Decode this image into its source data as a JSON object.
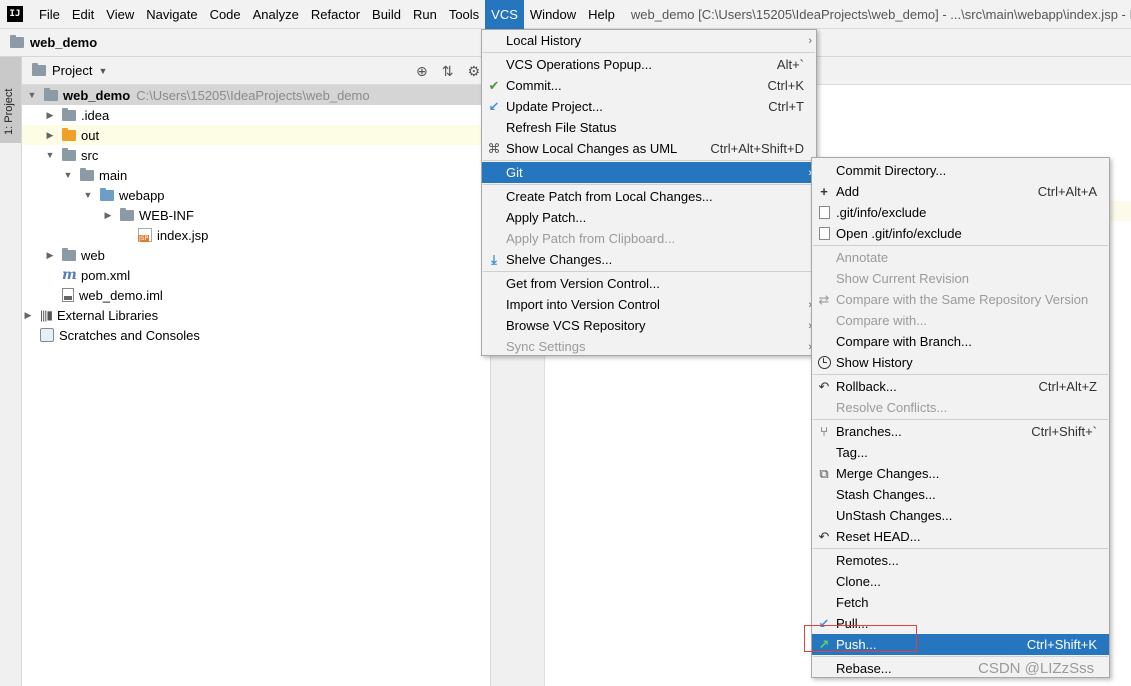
{
  "menubar": {
    "items": [
      "File",
      "Edit",
      "View",
      "Navigate",
      "Code",
      "Analyze",
      "Refactor",
      "Build",
      "Run",
      "Tools",
      "VCS",
      "Window",
      "Help"
    ],
    "active": "VCS",
    "window_title": "web_demo [C:\\Users\\15205\\IdeaProjects\\web_demo] - ...\\src\\main\\webapp\\index.jsp - I"
  },
  "navbar": {
    "project": "web_demo"
  },
  "tool_strip": {
    "project_tab": "1: Project"
  },
  "project_panel": {
    "title": "Project",
    "root": {
      "name": "web_demo",
      "path": "C:\\Users\\15205\\IdeaProjects\\web_demo"
    },
    "nodes": {
      "idea": ".idea",
      "out": "out",
      "src": "src",
      "main": "main",
      "webapp": "webapp",
      "webinf": "WEB-INF",
      "indexjsp": "index.jsp",
      "web": "web",
      "pom": "pom.xml",
      "iml": "web_demo.iml",
      "extlibs": "External Libraries",
      "scratches": "Scratches and Consoles"
    }
  },
  "vcs_menu": {
    "local_history": "Local History",
    "vcs_popup": "VCS Operations Popup...",
    "vcs_popup_sc": "Alt+`",
    "commit": "Commit...",
    "commit_sc": "Ctrl+K",
    "update": "Update Project...",
    "update_sc": "Ctrl+T",
    "refresh": "Refresh File Status",
    "show_uml": "Show Local Changes as UML",
    "show_uml_sc": "Ctrl+Alt+Shift+D",
    "git": "Git",
    "create_patch": "Create Patch from Local Changes...",
    "apply_patch": "Apply Patch...",
    "apply_clipboard": "Apply Patch from Clipboard...",
    "shelve": "Shelve Changes...",
    "get_vc": "Get from Version Control...",
    "import_vc": "Import into Version Control",
    "browse": "Browse VCS Repository",
    "sync": "Sync Settings"
  },
  "git_menu": {
    "commit_dir": "Commit Directory...",
    "add": "Add",
    "add_sc": "Ctrl+Alt+A",
    "exclude": ".git/info/exclude",
    "open_exclude": "Open .git/info/exclude",
    "annotate": "Annotate",
    "show_current": "Show Current Revision",
    "compare_repo": "Compare with the Same Repository Version",
    "compare_with": "Compare with...",
    "compare_branch": "Compare with Branch...",
    "show_history": "Show History",
    "rollback": "Rollback...",
    "rollback_sc": "Ctrl+Alt+Z",
    "resolve": "Resolve Conflicts...",
    "branches": "Branches...",
    "branches_sc": "Ctrl+Shift+`",
    "tag": "Tag...",
    "merge": "Merge Changes...",
    "stash": "Stash Changes...",
    "unstash": "UnStash Changes...",
    "reset": "Reset HEAD...",
    "remotes": "Remotes...",
    "clone": "Clone...",
    "fetch": "Fetch",
    "pull": "Pull...",
    "push": "Push...",
    "push_sc": "Ctrl+Shift+K",
    "rebase": "Rebase..."
  },
  "watermark": "CSDN @LIZzSss",
  "colors": {
    "selection": "#2675bf",
    "highlight_box": "#e04040"
  }
}
